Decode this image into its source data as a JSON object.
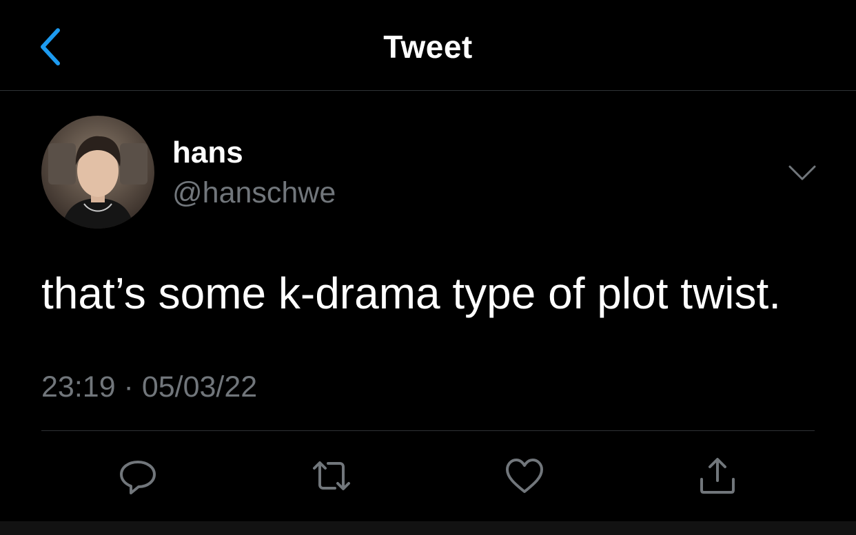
{
  "nav": {
    "title": "Tweet",
    "back_icon": "chevron-left-icon",
    "accent_color": "#1d9bf0"
  },
  "tweet": {
    "author": {
      "name": "hans",
      "handle": "@hanschwe",
      "avatar_icon": "avatar"
    },
    "text": "that’s some k-drama type of plot twist.",
    "time": "23:19 · 05/03/22",
    "more_icon": "chevron-down-icon"
  },
  "actions": [
    {
      "name": "reply",
      "icon": "reply-icon"
    },
    {
      "name": "retweet",
      "icon": "retweet-icon"
    },
    {
      "name": "like",
      "icon": "heart-icon"
    },
    {
      "name": "share",
      "icon": "share-icon"
    }
  ],
  "colors": {
    "background": "#000000",
    "text_primary": "#ffffff",
    "text_secondary": "#71767b",
    "divider": "#2f3336"
  }
}
